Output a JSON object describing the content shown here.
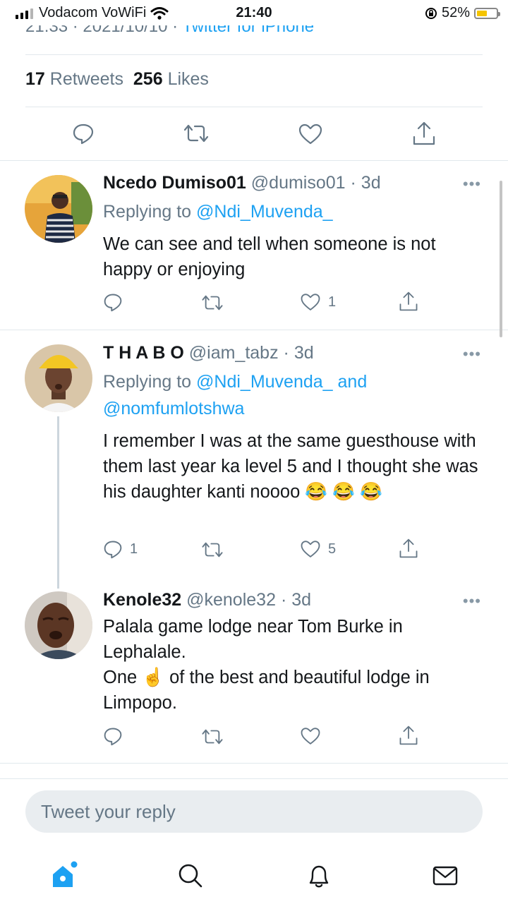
{
  "status_bar": {
    "carrier": "Vodacom VoWiFi",
    "time": "21:40",
    "battery": "52%"
  },
  "tweet": {
    "meta_cut": "21:33 · 2021/10/10 · ",
    "meta_source": "Twitter for iPhone",
    "retweets": "17",
    "retweets_label": "Retweets",
    "likes": "256",
    "likes_label": "Likes"
  },
  "replies": [
    {
      "name": "Ncedo Dumiso01",
      "handle": "@dumiso01",
      "time": "· 3d",
      "replying_label": "Replying to",
      "replying_to": "@Ndi_Muvenda_",
      "text": "We can see and tell when someone is not happy or enjoying",
      "reply_count": "",
      "like_count": "1"
    },
    {
      "name": "T H A B O",
      "handle": "@iam_tabz",
      "time": "· 3d",
      "replying_label": "Replying to",
      "replying_to": "@Ndi_Muvenda_",
      "replying_and": "and",
      "replying_to_2": "@nomfumlotshwa",
      "text": "I remember I was at the same guesthouse with them last year ka level 5 and I thought she was his daughter kanti noooo 😂 😂 😂",
      "reply_count": "1",
      "like_count": "5"
    },
    {
      "name": "Kenole32",
      "handle": "@kenole32",
      "time": "· 3d",
      "text_line1": "Palala game lodge near Tom Burke in Lephalale.",
      "text_line2": "One ☝️ of the best and beautiful lodge in Limpopo.",
      "reply_count": "",
      "like_count": ""
    }
  ],
  "composer": {
    "placeholder": "Tweet your reply"
  },
  "colors": {
    "accent": "#1da1f2",
    "muted": "#657786",
    "divider": "#e1e8ed"
  },
  "icons": [
    "reply-icon",
    "retweet-icon",
    "like-icon",
    "share-icon",
    "more-icon",
    "home-icon",
    "search-icon",
    "notifications-icon",
    "messages-icon"
  ]
}
